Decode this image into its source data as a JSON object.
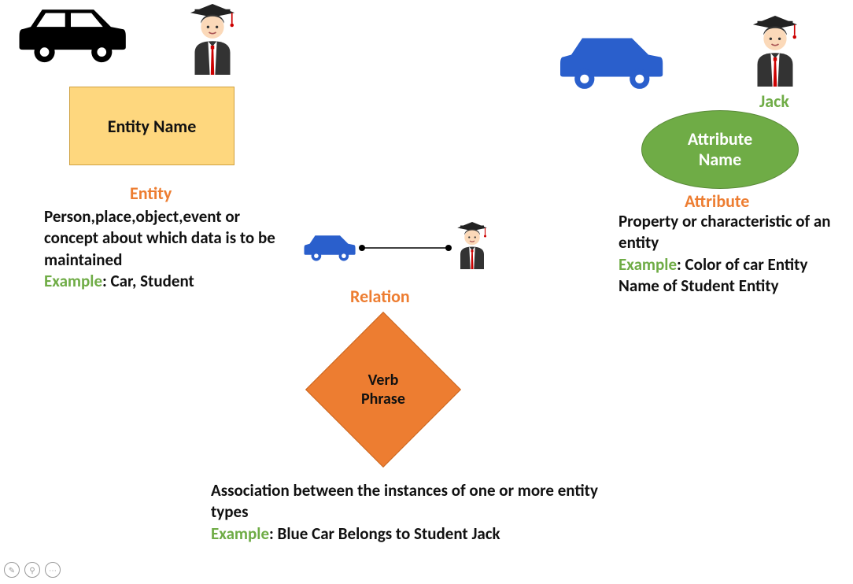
{
  "entity": {
    "shape_label": "Entity Name",
    "title": "Entity",
    "description": "Person,place,object,event or concept about which data is to be maintained",
    "example_label": "Example",
    "example_text": ": Car, Student"
  },
  "relation": {
    "shape_label_line1": "Verb",
    "shape_label_line2": "Phrase",
    "title": "Relation",
    "description": "Association between the instances of one or more entity types",
    "example_label": "Example",
    "example_text": ": Blue Car Belongs to Student Jack"
  },
  "attribute": {
    "student_name": "Jack",
    "shape_label_line1": "Attribute",
    "shape_label_line2": "Name",
    "title": "Attribute",
    "description": "Property or characteristic of an entity",
    "example_label": "Example",
    "example_text": ": Color of car Entity",
    "example_text2": "Name of Student Entity"
  }
}
